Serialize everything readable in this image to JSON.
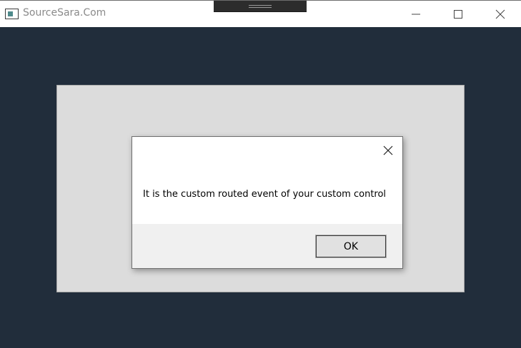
{
  "window": {
    "title": "SourceSara.Com",
    "controls": {
      "minimize": "minimize-icon",
      "maximize": "maximize-icon",
      "close": "close-icon"
    }
  },
  "colors": {
    "titlebar": "#ffffff",
    "client_background": "#212d3b",
    "panel": "#dcdcdc",
    "dialog": "#ffffff",
    "dialog_footer": "#f0f0f0"
  },
  "dialog": {
    "message": "It is the custom routed event of your custom control",
    "ok_label": "OK"
  }
}
